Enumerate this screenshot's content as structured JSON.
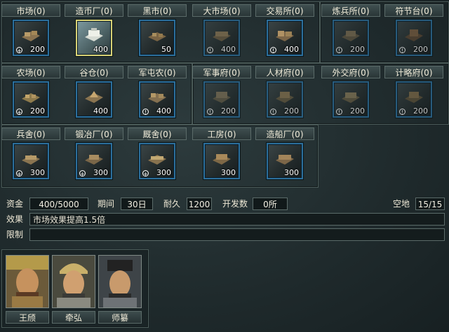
{
  "buildings": {
    "rows": [
      [
        {
          "label": "市场(0)",
          "cost": "200",
          "mark": "+",
          "icon": "market-icon"
        },
        {
          "label": "造币厂(0)",
          "cost": "400",
          "mark": "",
          "icon": "mint-icon",
          "selected": true
        },
        {
          "label": "黑市(0)",
          "cost": "50",
          "mark": "",
          "icon": "black-market-icon"
        },
        {
          "label": "大市场(0)",
          "cost": "400",
          "mark": "!",
          "icon": "grand-market-icon",
          "dim": true
        },
        {
          "label": "交易所(0)",
          "cost": "400",
          "mark": "!",
          "icon": "exchange-icon"
        },
        {
          "label": "炼兵所(0)",
          "cost": "200",
          "mark": "!",
          "icon": "training-ground-icon",
          "dim": true
        },
        {
          "label": "符节台(0)",
          "cost": "200",
          "mark": "!",
          "icon": "tally-tower-icon",
          "dim": true
        }
      ],
      [
        {
          "label": "农场(0)",
          "cost": "200",
          "mark": "+",
          "icon": "farm-icon"
        },
        {
          "label": "谷仓(0)",
          "cost": "400",
          "mark": "",
          "icon": "granary-icon"
        },
        {
          "label": "军屯农(0)",
          "cost": "400",
          "mark": "!",
          "icon": "military-farm-icon"
        },
        {
          "label": "军事府(0)",
          "cost": "200",
          "mark": "!",
          "icon": "military-office-icon",
          "dim": true
        },
        {
          "label": "人材府(0)",
          "cost": "200",
          "mark": "!",
          "icon": "talent-office-icon",
          "dim": true
        },
        {
          "label": "外交府(0)",
          "cost": "200",
          "mark": "!",
          "icon": "diplomacy-office-icon",
          "dim": true
        },
        {
          "label": "计略府(0)",
          "cost": "200",
          "mark": "!",
          "icon": "strategy-office-icon",
          "dim": true
        }
      ],
      [
        {
          "label": "兵舍(0)",
          "cost": "300",
          "mark": "+",
          "icon": "barracks-icon"
        },
        {
          "label": "锻冶厂(0)",
          "cost": "300",
          "mark": "+",
          "icon": "forge-icon"
        },
        {
          "label": "厩舍(0)",
          "cost": "300",
          "mark": "+",
          "icon": "stable-icon"
        },
        {
          "label": "工房(0)",
          "cost": "300",
          "mark": "",
          "icon": "workshop-icon"
        },
        {
          "label": "造船厂(0)",
          "cost": "300",
          "mark": "",
          "icon": "shipyard-icon"
        }
      ]
    ]
  },
  "info": {
    "funds_label": "资金",
    "funds": "400/5000",
    "period_label": "期间",
    "period": "30日",
    "durability_label": "耐久",
    "durability": "1200",
    "develop_label": "开发数",
    "develop": "0所",
    "vacant_label": "空地",
    "vacant": "15/15",
    "effect_label": "效果",
    "effect": "市场效果提高1.5倍",
    "limit_label": "限制",
    "limit": ""
  },
  "officers": [
    {
      "name": "王颀",
      "icon": "officer-portrait-icon"
    },
    {
      "name": "牵弘",
      "icon": "officer-portrait-icon"
    },
    {
      "name": "师纂",
      "icon": "officer-portrait-icon"
    }
  ],
  "colors": {
    "accent": "#2c6f9c",
    "selected": "#d8d276",
    "panel": "#1f2a2c"
  }
}
